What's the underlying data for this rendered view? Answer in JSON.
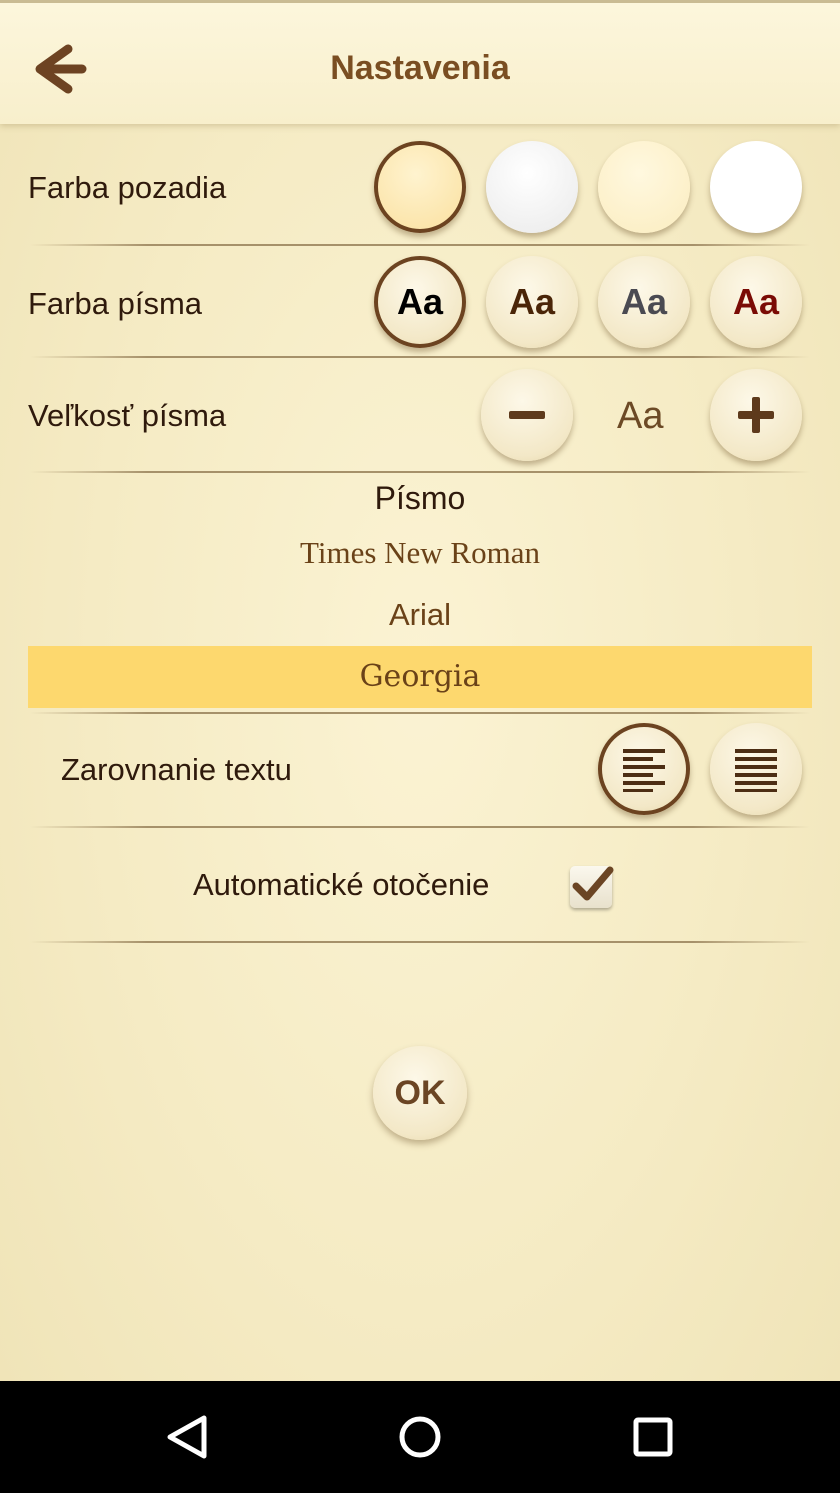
{
  "header": {
    "title": "Nastavenia",
    "back_icon": "arrow-left-icon"
  },
  "background_color": {
    "label": "Farba pozadia",
    "swatches": [
      {
        "color": "#fbe7b3",
        "selected": true
      },
      {
        "color": "#f1f1f1",
        "selected": false
      },
      {
        "color": "#fdf0c8",
        "selected": false
      },
      {
        "color": "#ffffff",
        "selected": false
      }
    ]
  },
  "text_color": {
    "label": "Farba písma",
    "options": [
      {
        "text": "Aa",
        "color": "#000000",
        "selected": true
      },
      {
        "text": "Aa",
        "color": "#4a2508",
        "selected": false
      },
      {
        "text": "Aa",
        "color": "#4a4a52",
        "selected": false
      },
      {
        "text": "Aa",
        "color": "#7a0b05",
        "selected": false
      }
    ]
  },
  "font_size": {
    "label": "Veľkosť písma",
    "preview": "Aa",
    "minus_icon": "minus-icon",
    "plus_icon": "plus-icon"
  },
  "font": {
    "heading": "Písmo",
    "options": [
      {
        "name": "Times New Roman",
        "selected": false
      },
      {
        "name": "Arial",
        "selected": false
      },
      {
        "name": "Georgia",
        "selected": true
      }
    ]
  },
  "alignment": {
    "label": "Zarovnanie textu",
    "options": [
      {
        "icon": "align-left-icon",
        "selected": true
      },
      {
        "icon": "align-justify-icon",
        "selected": false
      }
    ]
  },
  "auto_rotate": {
    "label": "Automatické otočenie",
    "checked": true
  },
  "ok_button": {
    "label": "OK"
  },
  "navbar": {
    "back_icon": "nav-back-icon",
    "home_icon": "nav-home-icon",
    "recents_icon": "nav-recents-icon"
  }
}
